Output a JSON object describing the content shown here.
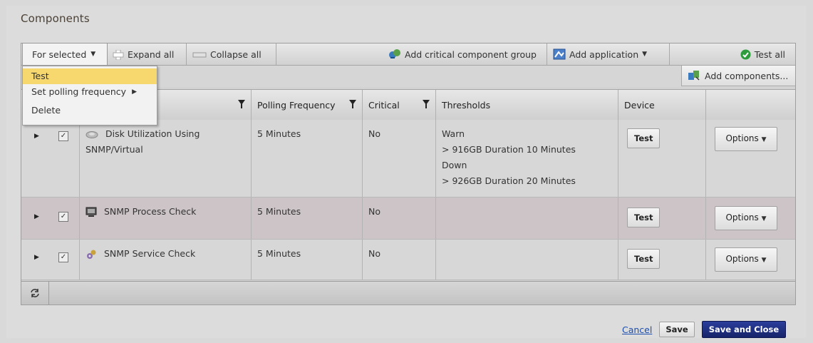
{
  "page": {
    "title": "Components"
  },
  "toolbar": {
    "for_selected": "For selected",
    "expand_all": "Expand all",
    "collapse_all": "Collapse all",
    "add_critical_group": "Add critical component group",
    "add_application": "Add application",
    "test_all": "Test all",
    "add_components": "Add components..."
  },
  "menu": {
    "items": [
      {
        "label": "Test",
        "highlighted": true
      },
      {
        "label": "Set polling frequency"
      },
      {
        "label": "Delete"
      }
    ]
  },
  "table": {
    "columns": [
      "Polling Frequency",
      "Critical",
      "Thresholds",
      "Device"
    ],
    "rows": [
      {
        "name_line1": "Disk Utilization Using",
        "name_line2": "SNMP/Virtual",
        "icon": "disk-icon",
        "polling": "5 Minutes",
        "critical": "No",
        "thresholds": [
          "Warn",
          "> 916GB Duration 10 Minutes",
          "Down",
          "> 926GB Duration 20 Minutes"
        ],
        "test_label": "Test",
        "options_label": "Options"
      },
      {
        "name_line1": "SNMP Process Check",
        "icon": "process-icon",
        "polling": "5 Minutes",
        "critical": "No",
        "thresholds": [],
        "test_label": "Test",
        "options_label": "Options"
      },
      {
        "name_line1": "SNMP Service Check",
        "icon": "service-icon",
        "polling": "5 Minutes",
        "critical": "No",
        "thresholds": [],
        "test_label": "Test",
        "options_label": "Options"
      }
    ]
  },
  "footer": {
    "cancel": "Cancel",
    "save": "Save",
    "save_close": "Save and Close"
  },
  "colors": {
    "menu_highlight": "#f7d86f",
    "primary_button": "#1f2f86",
    "link": "#1c4fb0",
    "alt_row": "#cdc4c8"
  }
}
